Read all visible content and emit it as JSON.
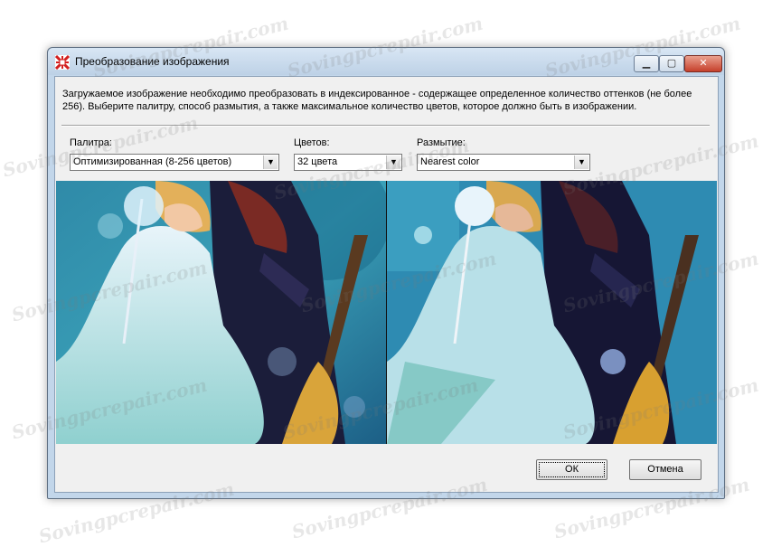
{
  "window": {
    "title": "Преобразование изображения",
    "controls": {
      "minimize": "▁",
      "maximize": "▢",
      "close": "✕"
    }
  },
  "description": "Загружаемое изображение необходимо преобразовать в индексированное - содержащее определенное количество оттенков (не более 256). Выберите палитру, способ размытия, а также максимальное количество цветов, которое должно быть в изображении.",
  "palette": {
    "label": "Палитра:",
    "value": "Оптимизированная (8-256 цветов)"
  },
  "colors": {
    "label": "Цветов:",
    "value": "32 цвета"
  },
  "dithering": {
    "label": "Размытие:",
    "value": "Nearest color"
  },
  "buttons": {
    "ok": "ОК",
    "cancel": "Отмена"
  },
  "watermark": "Sovingpcrepair.com",
  "icons": {
    "app": "app-icon",
    "dropdown": "chevron-down-icon",
    "arrow_glyph": "▼"
  },
  "colors_theme": {
    "title_bar": "#c9dbee",
    "dialog_bg": "#f0f0f0",
    "close_red": "#c6402b"
  }
}
